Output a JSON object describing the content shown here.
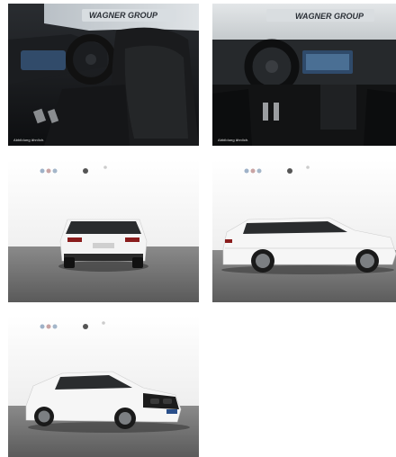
{
  "gallery": {
    "items": [
      {
        "caption": "Abbildung ähnlich.",
        "banner": "WAGNER GROUP"
      },
      {
        "caption": "Abbildung ähnlich.",
        "banner": "WAGNER GROUP"
      },
      {
        "caption": ""
      },
      {
        "caption": ""
      },
      {
        "caption": ""
      }
    ]
  },
  "icons": [
    "dealer-brand-logos",
    "car-photo"
  ]
}
